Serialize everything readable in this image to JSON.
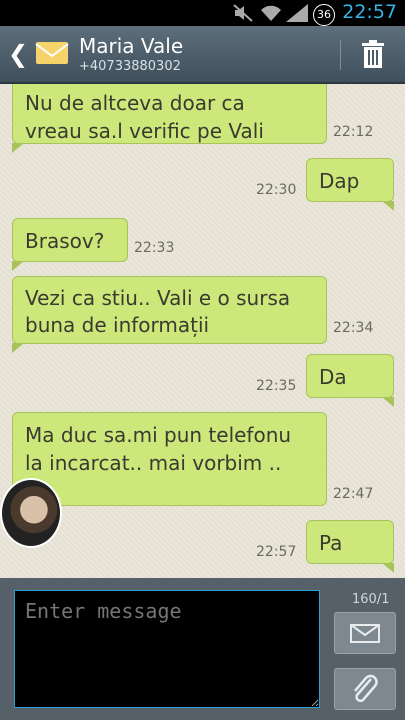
{
  "status": {
    "battery": "36",
    "time": "22:57"
  },
  "header": {
    "contact_name": "Maria Vale",
    "contact_number": "+40733880302"
  },
  "messages": [
    {
      "text": "Nu de altceva doar ca\nvreau sa.l verific pe Vali",
      "time": "22:12"
    },
    {
      "text": "Dap",
      "time": "22:30"
    },
    {
      "text": "Brasov?",
      "time": "22:33"
    },
    {
      "text": "Vezi ca stiu.. Vali e o sursa\nbuna de informații",
      "time": "22:34"
    },
    {
      "text": "Da",
      "time": "22:35"
    },
    {
      "text": "Ma duc sa.mi pun telefonu\nla incarcat.. mai vorbim ..\n:*",
      "time": "22:47"
    },
    {
      "text": "Pa",
      "time": "22:57"
    }
  ],
  "composer": {
    "placeholder": "Enter message",
    "counter": "160/1"
  }
}
